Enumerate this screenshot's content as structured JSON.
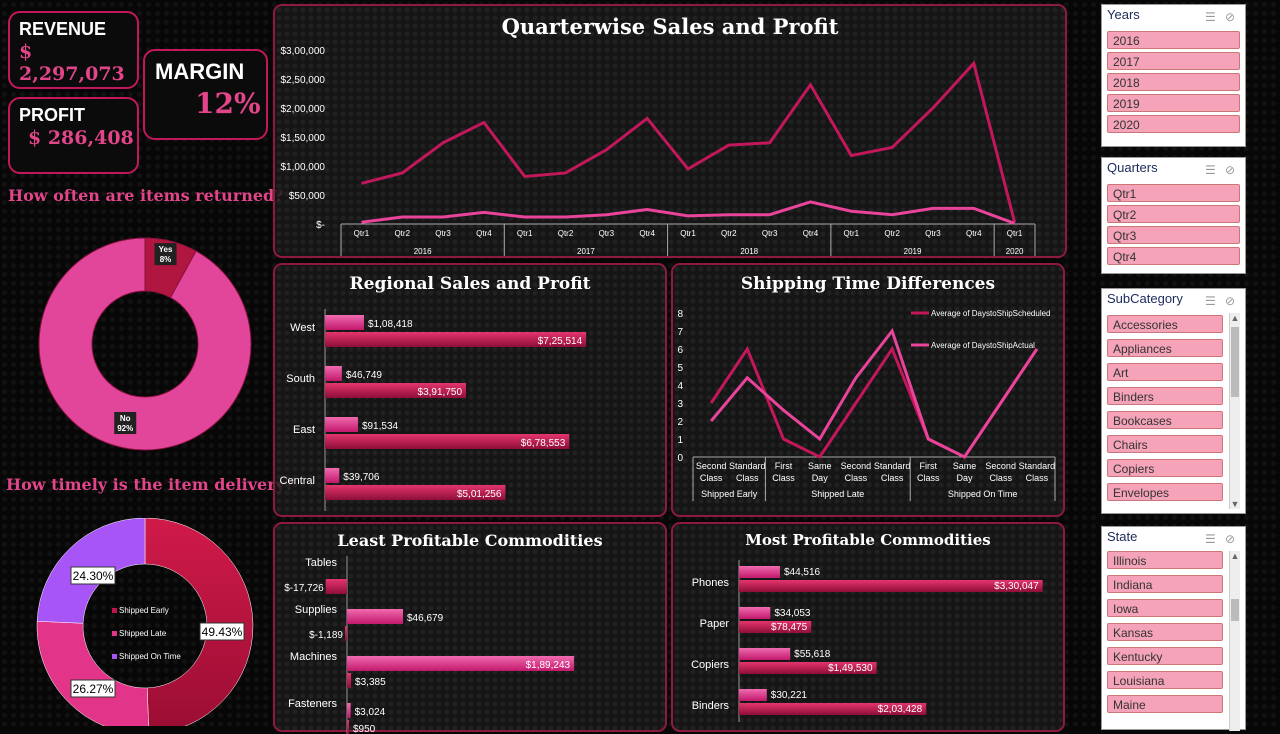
{
  "kpis": {
    "revenue_label": "REVENUE",
    "revenue_value": "$ 2,297,073",
    "profit_label": "PROFIT",
    "profit_value": "$ 286,408",
    "margin_label": "MARGIN",
    "margin_value": "12%"
  },
  "questions": {
    "returns": "How often are items returned?",
    "delivery": "How timely is the item delivery?"
  },
  "panels": {
    "quarterwise": "Quarterwise Sales and Profit",
    "regional": "Regional Sales and Profit",
    "shipping": "Shipping Time Differences",
    "least": "Least Profitable Commodities",
    "most": "Most Profitable Commodities"
  },
  "slicers": {
    "years": {
      "title": "Years",
      "items": [
        "2016",
        "2017",
        "2018",
        "2019",
        "2020"
      ]
    },
    "quarters": {
      "title": "Quarters",
      "items": [
        "Qtr1",
        "Qtr2",
        "Qtr3",
        "Qtr4"
      ]
    },
    "subcategory": {
      "title": "SubCategory",
      "items": [
        "Accessories",
        "Appliances",
        "Art",
        "Binders",
        "Bookcases",
        "Chairs",
        "Copiers",
        "Envelopes"
      ]
    },
    "state": {
      "title": "State",
      "items": [
        "Illinois",
        "Indiana",
        "Iowa",
        "Kansas",
        "Kentucky",
        "Louisiana",
        "Maine"
      ]
    }
  },
  "colors": {
    "sales": "#c2185b",
    "profit": "#e8449a",
    "late": "#e2358a",
    "on_time": "#a855f7",
    "border": "#8e1a3e"
  },
  "chart_data": [
    {
      "type": "line",
      "title": "Quarterwise Sales and Profit",
      "x": [
        "Qtr1",
        "Qtr2",
        "Qtr3",
        "Qtr4",
        "Qtr1",
        "Qtr2",
        "Qtr3",
        "Qtr4",
        "Qtr1",
        "Qtr2",
        "Qtr3",
        "Qtr4",
        "Qtr1",
        "Qtr2",
        "Qtr3",
        "Qtr4",
        "Qtr1"
      ],
      "x_groups": [
        {
          "label": "2016",
          "span": 4
        },
        {
          "label": "2017",
          "span": 4
        },
        {
          "label": "2018",
          "span": 4
        },
        {
          "label": "2019",
          "span": 4
        },
        {
          "label": "2020",
          "span": 1
        }
      ],
      "yticks": [
        "$3,00,000",
        "$2,50,000",
        "$2,00,000",
        "$1,50,000",
        "$1,00,000",
        "$50,000",
        "$-"
      ],
      "ylim": [
        0,
        300000
      ],
      "series": [
        {
          "values": [
            70000,
            88000,
            140000,
            175000,
            82000,
            88000,
            128000,
            182000,
            95000,
            136000,
            140000,
            240000,
            118000,
            132000,
            200000,
            277000,
            3000
          ]
        },
        {
          "values": [
            3000,
            12000,
            12000,
            20000,
            12000,
            12000,
            16000,
            25000,
            14000,
            16000,
            16000,
            38000,
            22000,
            16000,
            27000,
            27000,
            1000
          ]
        }
      ]
    },
    {
      "type": "bar",
      "title": "Regional Sales and Profit",
      "categories": [
        "West",
        "South",
        "East",
        "Central"
      ],
      "series": [
        {
          "values": [
            108418,
            46749,
            91534,
            39706
          ],
          "labels": [
            "$1,08,418",
            "$46,749",
            "$91,534",
            "$39,706"
          ]
        },
        {
          "values": [
            725514,
            391750,
            678553,
            501256
          ],
          "labels": [
            "$7,25,514",
            "$3,91,750",
            "$6,78,553",
            "$5,01,256"
          ]
        }
      ]
    },
    {
      "type": "line",
      "title": "Shipping Time Differences",
      "x": [
        [
          "Second",
          "Class"
        ],
        [
          "Standard",
          "Class"
        ],
        [
          "First",
          "Class"
        ],
        [
          "Same",
          "Day"
        ],
        [
          "Second",
          "Class"
        ],
        [
          "Standard",
          "Class"
        ],
        [
          "First",
          "Class"
        ],
        [
          "Same",
          "Day"
        ],
        [
          "Second",
          "Class"
        ],
        [
          "Standard",
          "Class"
        ]
      ],
      "x_groups": [
        {
          "label": "Shipped Early",
          "span": 2
        },
        {
          "label": "Shipped Late",
          "span": 4
        },
        {
          "label": "Shipped On Time",
          "span": 4
        }
      ],
      "yticks": [
        "8",
        "7",
        "6",
        "5",
        "4",
        "3",
        "2",
        "1",
        "0"
      ],
      "ylim": [
        0,
        8
      ],
      "series": [
        {
          "name": "Average of DaystoShipScheduled",
          "values": [
            3,
            6,
            1,
            0,
            3,
            6,
            1,
            0,
            3,
            6
          ]
        },
        {
          "name": "Average of DaystoShipActual",
          "values": [
            2,
            4.4,
            2.6,
            1,
            4.4,
            7,
            1,
            0,
            3,
            6
          ]
        }
      ]
    },
    {
      "type": "bar",
      "title": "Least Profitable Commodities",
      "categories": [
        "Tables",
        "Supplies",
        "Machines",
        "Fasteners"
      ],
      "series": [
        {
          "values": [
            null,
            46679,
            189243,
            3024
          ],
          "labels": [
            "",
            "$46,679",
            "$1,89,243",
            "$3,024"
          ]
        },
        {
          "values": [
            -17726,
            -1189,
            3385,
            950
          ],
          "labels": [
            "$-17,726",
            "$-1,189",
            "$3,385",
            "$950"
          ]
        }
      ]
    },
    {
      "type": "bar",
      "title": "Most Profitable Commodities",
      "categories": [
        "Phones",
        "Paper",
        "Copiers",
        "Binders"
      ],
      "series": [
        {
          "values": [
            44516,
            34053,
            55618,
            30221
          ],
          "labels": [
            "$44,516",
            "$34,053",
            "$55,618",
            "$30,221"
          ]
        },
        {
          "values": [
            330047,
            78475,
            149530,
            203428
          ],
          "labels": [
            "$3,30,047",
            "$78,475",
            "$1,49,530",
            "$2,03,428"
          ]
        }
      ]
    },
    {
      "type": "pie",
      "slices": [
        {
          "label": "Yes",
          "pct": "8%",
          "value": 8
        },
        {
          "label": "No",
          "pct": "92%",
          "value": 92
        }
      ]
    },
    {
      "type": "pie",
      "slices": [
        {
          "label": "Shipped Early",
          "pct": "49.43%",
          "value": 49.43
        },
        {
          "label": "Shipped Late",
          "pct": "26.27%",
          "value": 26.27
        },
        {
          "label": "Shipped On Time",
          "pct": "24.30%",
          "value": 24.3
        }
      ]
    }
  ]
}
